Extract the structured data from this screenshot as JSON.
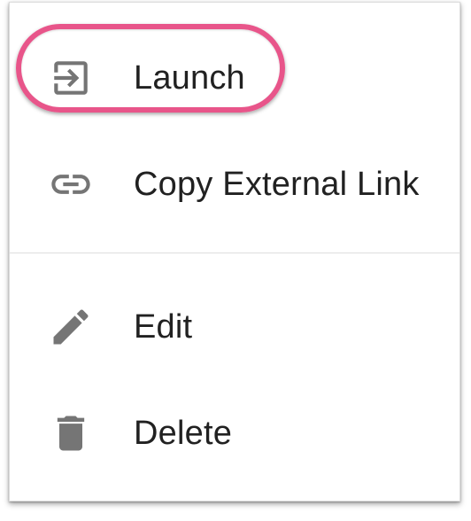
{
  "menu": {
    "items": [
      {
        "label": "Launch",
        "icon": "launch-icon"
      },
      {
        "label": "Copy External Link",
        "icon": "link-icon"
      },
      {
        "label": "Edit",
        "icon": "pencil-icon"
      },
      {
        "label": "Delete",
        "icon": "trash-icon"
      }
    ]
  },
  "colors": {
    "icon": "#757575",
    "text": "#212121",
    "highlight": "#e8558a"
  }
}
